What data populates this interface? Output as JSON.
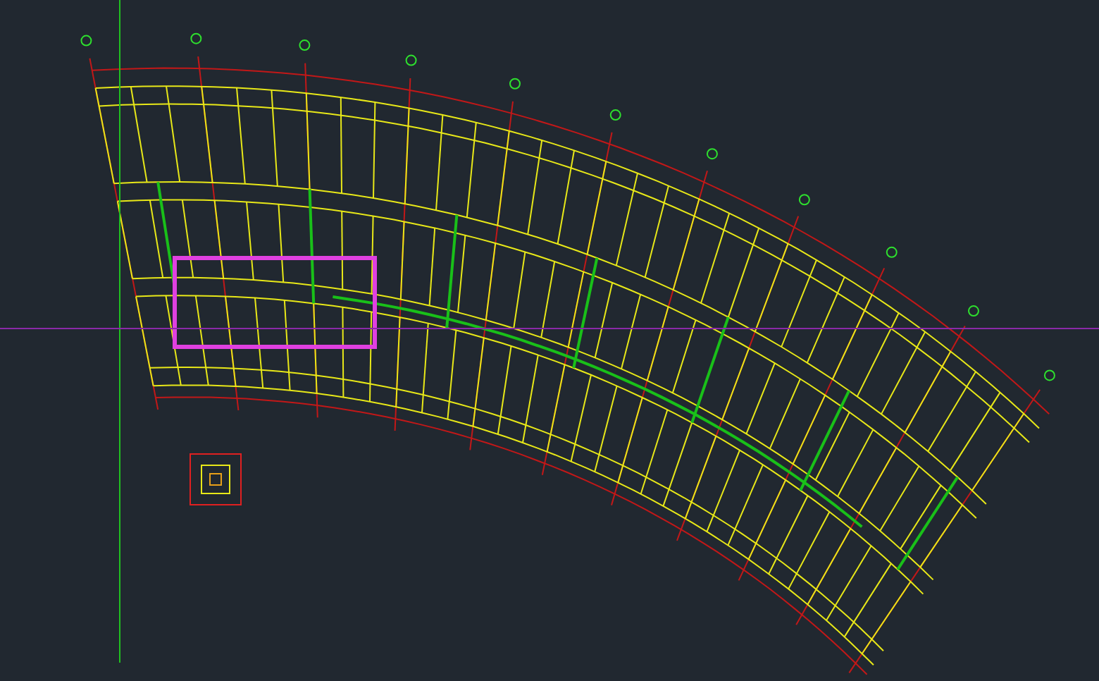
{
  "viewport": {
    "crosshair": true,
    "selection_window": true
  }
}
